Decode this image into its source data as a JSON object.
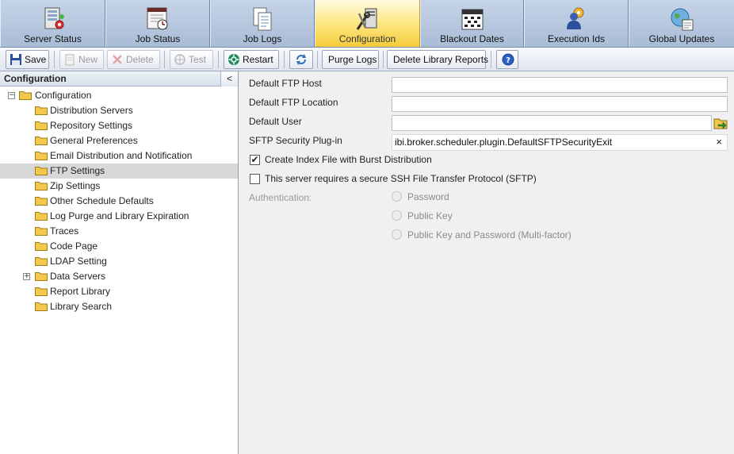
{
  "tabs": [
    {
      "label": "Server Status",
      "icon": "server-status-icon",
      "active": false
    },
    {
      "label": "Job Status",
      "icon": "job-status-icon",
      "active": false
    },
    {
      "label": "Job Logs",
      "icon": "job-logs-icon",
      "active": false
    },
    {
      "label": "Configuration",
      "icon": "configuration-icon",
      "active": true
    },
    {
      "label": "Blackout Dates",
      "icon": "calendar-icon",
      "active": false
    },
    {
      "label": "Execution Ids",
      "icon": "execution-ids-icon",
      "active": false
    },
    {
      "label": "Global Updates",
      "icon": "global-updates-icon",
      "active": false
    }
  ],
  "toolbar": {
    "save": "Save",
    "new": "New",
    "delete": "Delete",
    "test": "Test",
    "restart": "Restart",
    "purge_logs": "Purge Logs",
    "delete_library_reports": "Delete Library Reports"
  },
  "tree": {
    "title": "Configuration",
    "collapse": "<",
    "root": "Configuration",
    "items": [
      "Distribution Servers",
      "Repository Settings",
      "General Preferences",
      "Email Distribution and Notification",
      "FTP Settings",
      "Zip Settings",
      "Other Schedule Defaults",
      "Log Purge and Library Expiration",
      "Traces",
      "Code Page",
      "LDAP Setting",
      "Data Servers",
      "Report Library",
      "Library Search"
    ],
    "selected": "FTP Settings",
    "expander_collapsed": "+",
    "expander_expanded": "−"
  },
  "form": {
    "default_ftp_host_label": "Default FTP Host",
    "default_ftp_host_value": "",
    "default_ftp_location_label": "Default FTP Location",
    "default_ftp_location_value": "",
    "default_user_label": "Default User",
    "default_user_value": "",
    "sftp_plugin_label": "SFTP Security Plug-in",
    "sftp_plugin_value": "ibi.broker.scheduler.plugin.DefaultSFTPSecurityExit",
    "clear_symbol": "×",
    "create_index_label": "Create Index File with Burst Distribution",
    "create_index_checked": true,
    "sftp_required_label": "This server requires a secure SSH File Transfer Protocol (SFTP)",
    "sftp_required_checked": false,
    "check_mark": "✔",
    "authentication_label": "Authentication:",
    "auth_options": [
      "Password",
      "Public Key",
      "Public Key and Password (Multi-factor)"
    ]
  },
  "colors": {
    "active_tab": "#f5cb3a",
    "tab_bg": "#b4c6df",
    "selection": "#d8d8d8",
    "folder": "#f2c94c"
  }
}
